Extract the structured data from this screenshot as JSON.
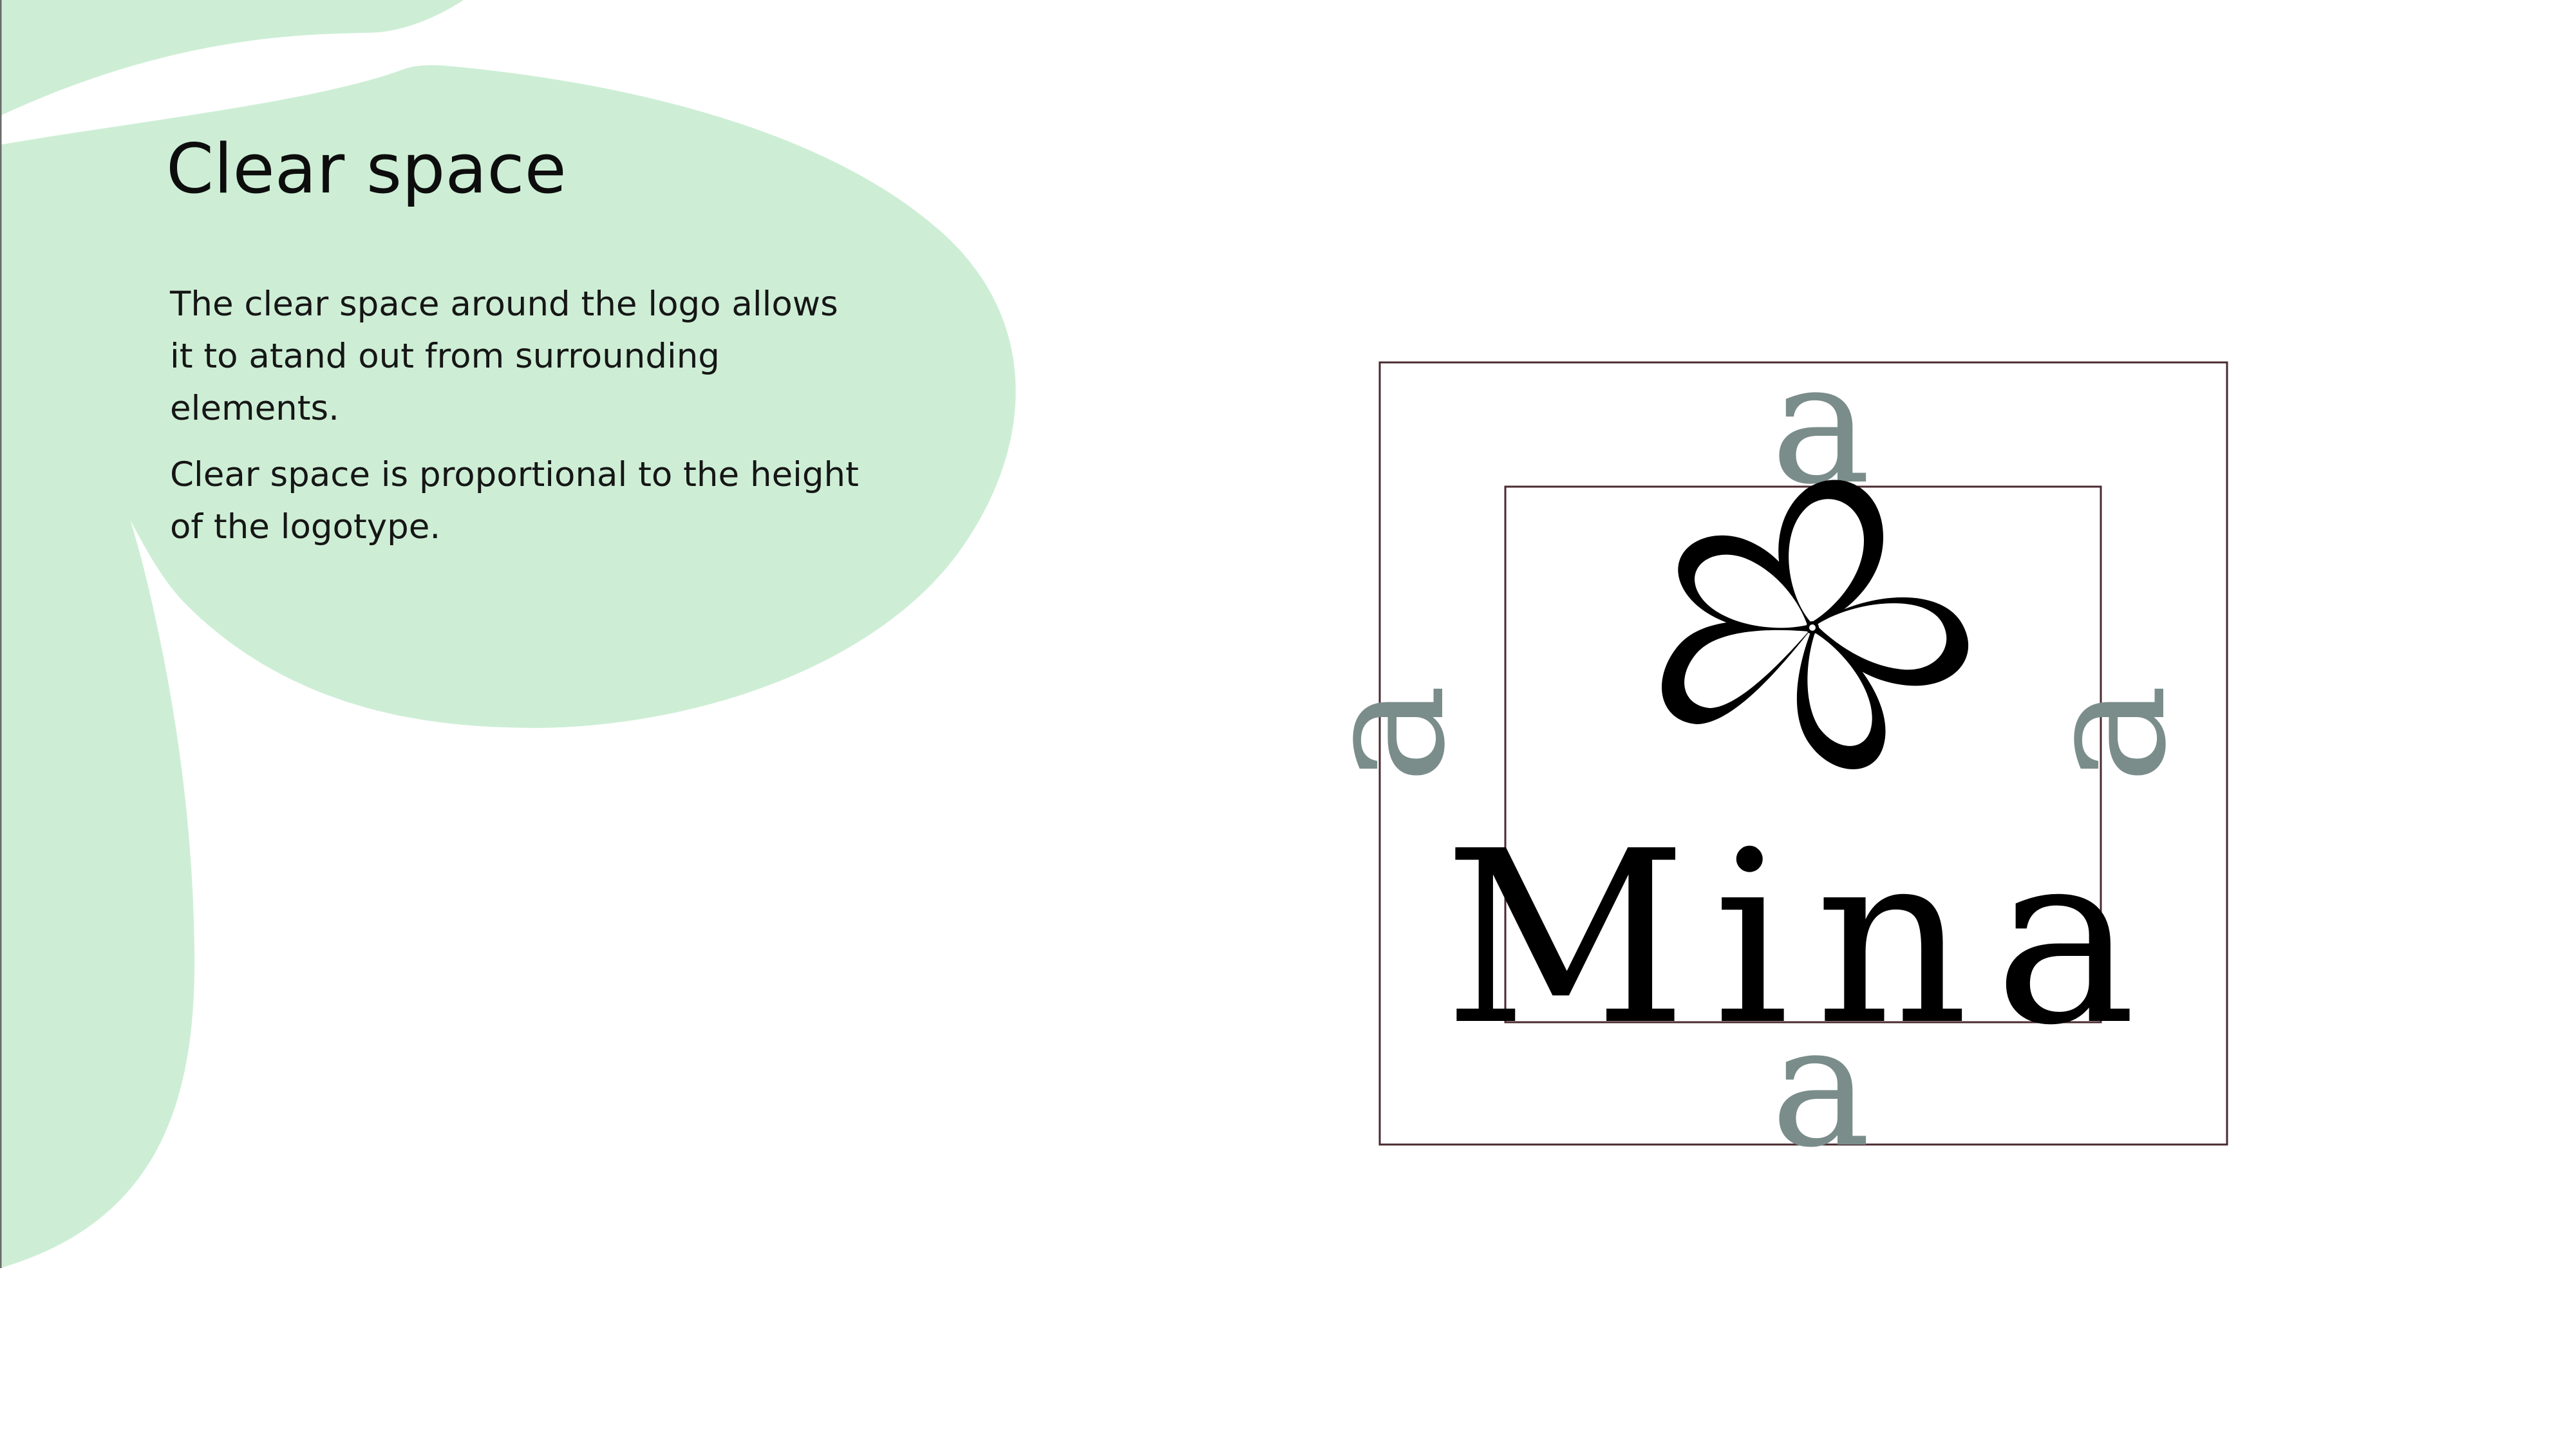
{
  "page": {
    "title": "Clear space",
    "paragraphs": [
      "The clear space around the logo allows it to atand out from surrounding elements.",
      "Clear space is proportional to the height of the logotype."
    ]
  },
  "logo": {
    "wordmark": "Mina",
    "clear_space_marker": "a",
    "flower_icon": "five-petal-flower-icon"
  },
  "colors": {
    "background_blob": "#cdeed5",
    "marker": "#7a8d8a",
    "frame_line": "#4a2a30",
    "ink": "#000000"
  }
}
